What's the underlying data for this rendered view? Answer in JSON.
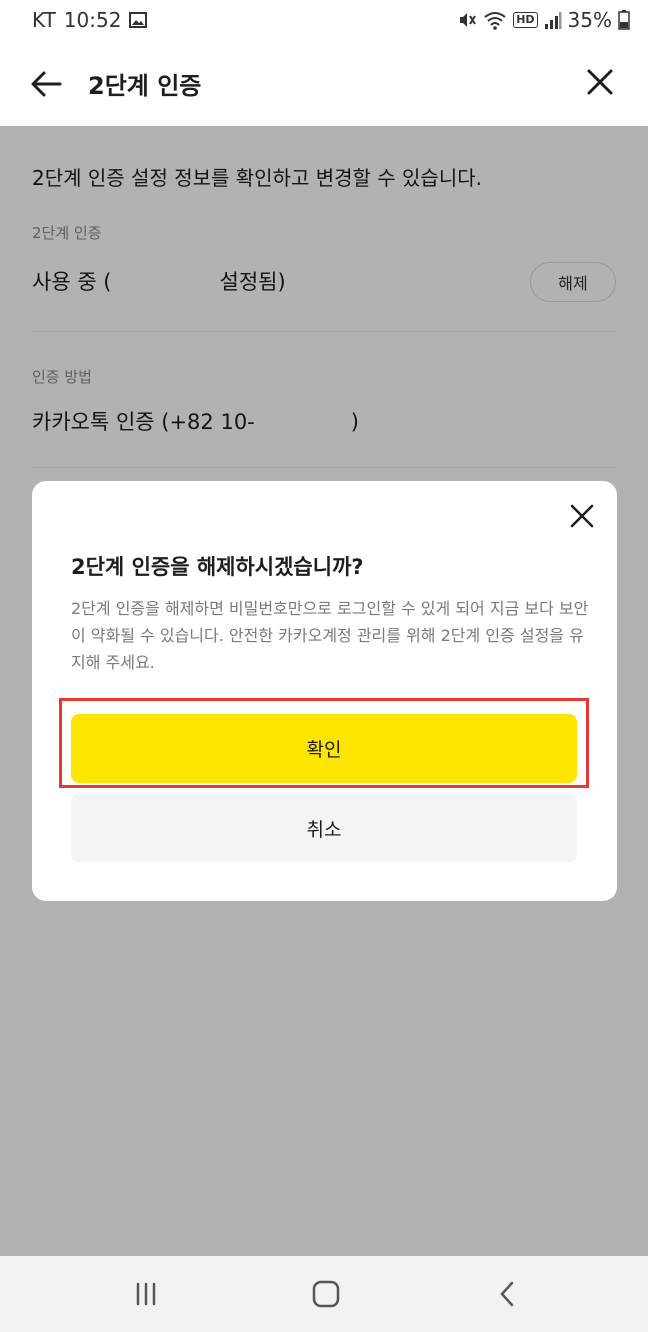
{
  "status": {
    "carrier": "KT",
    "time": "10:52",
    "battery": "35%",
    "hd_badge": "HD",
    "icons": [
      "image-icon",
      "mute-vibrate-icon",
      "wifi-icon",
      "hd-icon",
      "signal-icon",
      "battery-icon"
    ]
  },
  "header": {
    "title": "2단계 인증",
    "back_icon": "arrow-left-icon",
    "close_icon": "close-icon"
  },
  "content": {
    "description": "2단계 인증 설정 정보를 확인하고 변경할 수 있습니다.",
    "section1": {
      "label": "2단계 인증",
      "value_prefix": "사용 중 (",
      "value_suffix": "설정됨)",
      "button": "해제"
    },
    "section2": {
      "label": "인증 방법",
      "value_prefix": "카카오톡 인증 (+82 10-",
      "value_suffix": ")"
    }
  },
  "dialog": {
    "title": "2단계 인증을 해제하시겠습니까?",
    "message": "2단계 인증을 해제하면 비밀번호만으로 로그인할 수 있게 되어 지금 보다 보안이 약화될 수 있습니다. 안전한 카카오계정 관리를 위해 2단계 인증 설정을 유지해 주세요.",
    "confirm": "확인",
    "cancel": "취소"
  },
  "colors": {
    "accent_yellow": "#fee500",
    "highlight_red": "#e53935",
    "overlay": "#000000"
  }
}
